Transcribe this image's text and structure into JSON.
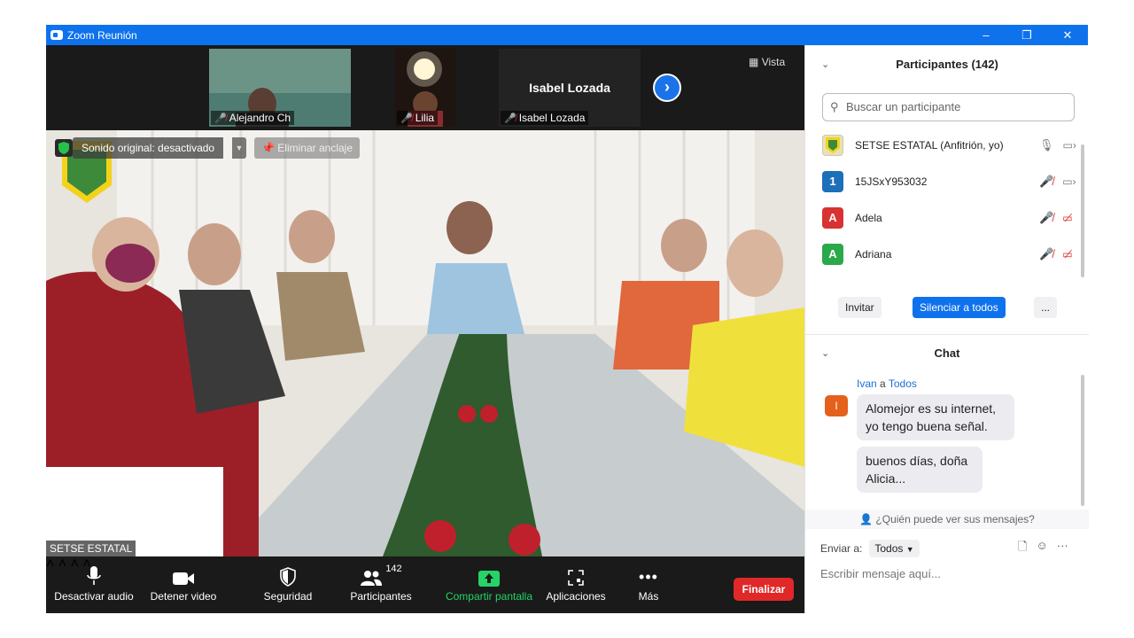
{
  "window": {
    "title": "Zoom Reunión",
    "controls": [
      "–",
      "❐",
      "✕"
    ]
  },
  "thumbnails": [
    {
      "name": "Alejandro Ch",
      "muted": true
    },
    {
      "name": "Lilia",
      "muted": true
    },
    {
      "name": "Isabel  Lozada",
      "muted": true,
      "display_name": "Isabel  Lozada"
    }
  ],
  "view_button": "Vista",
  "main_video": {
    "sound_status": "Sonido original: desactivado",
    "unpin_label": "Eliminar anclaje",
    "speaker_name": "SETSE ESTATAL"
  },
  "toolbar": {
    "mute": "Desactivar audio",
    "video": "Detener video",
    "security": "Seguridad",
    "participants": "Participantes",
    "participants_count": "142",
    "share": "Compartir pantalla",
    "apps": "Aplicaciones",
    "more": "Más",
    "end": "Finalizar"
  },
  "participants_panel": {
    "title": "Participantes (142)",
    "search_placeholder": "Buscar un participante",
    "items": [
      {
        "name": "SETSE ESTATAL (Anfitrión, yo)",
        "initial": "",
        "color": "#c9c9b8",
        "mic": "on",
        "video": "on"
      },
      {
        "name": "15JSxY953032",
        "initial": "1",
        "color": "#1d6fb8",
        "mic": "off",
        "video": "on"
      },
      {
        "name": "Adela",
        "initial": "A",
        "color": "#d83232",
        "mic": "off",
        "video": "off"
      },
      {
        "name": "Adriana",
        "initial": "A",
        "color": "#2aa84a",
        "mic": "off",
        "video": "off"
      }
    ],
    "invite": "Invitar",
    "mute_all": "Silenciar a todos",
    "more": "..."
  },
  "chat": {
    "title": "Chat",
    "sender": "Ivan",
    "to_word": "a",
    "recipient": "Todos",
    "sender_initial": "I",
    "messages": [
      "Alomejor es su internet, yo tengo buena señal.",
      "buenos días, doña Alicia..."
    ],
    "visibility": "¿Quién puede ver sus mensajes?",
    "send_to_label": "Enviar a:",
    "send_to_value": "Todos",
    "input_placeholder": "Escribir mensaje aquí..."
  },
  "icons": {
    "accent": "#0e72ed",
    "end_red": "#e02828",
    "share_green": "#25d366"
  }
}
